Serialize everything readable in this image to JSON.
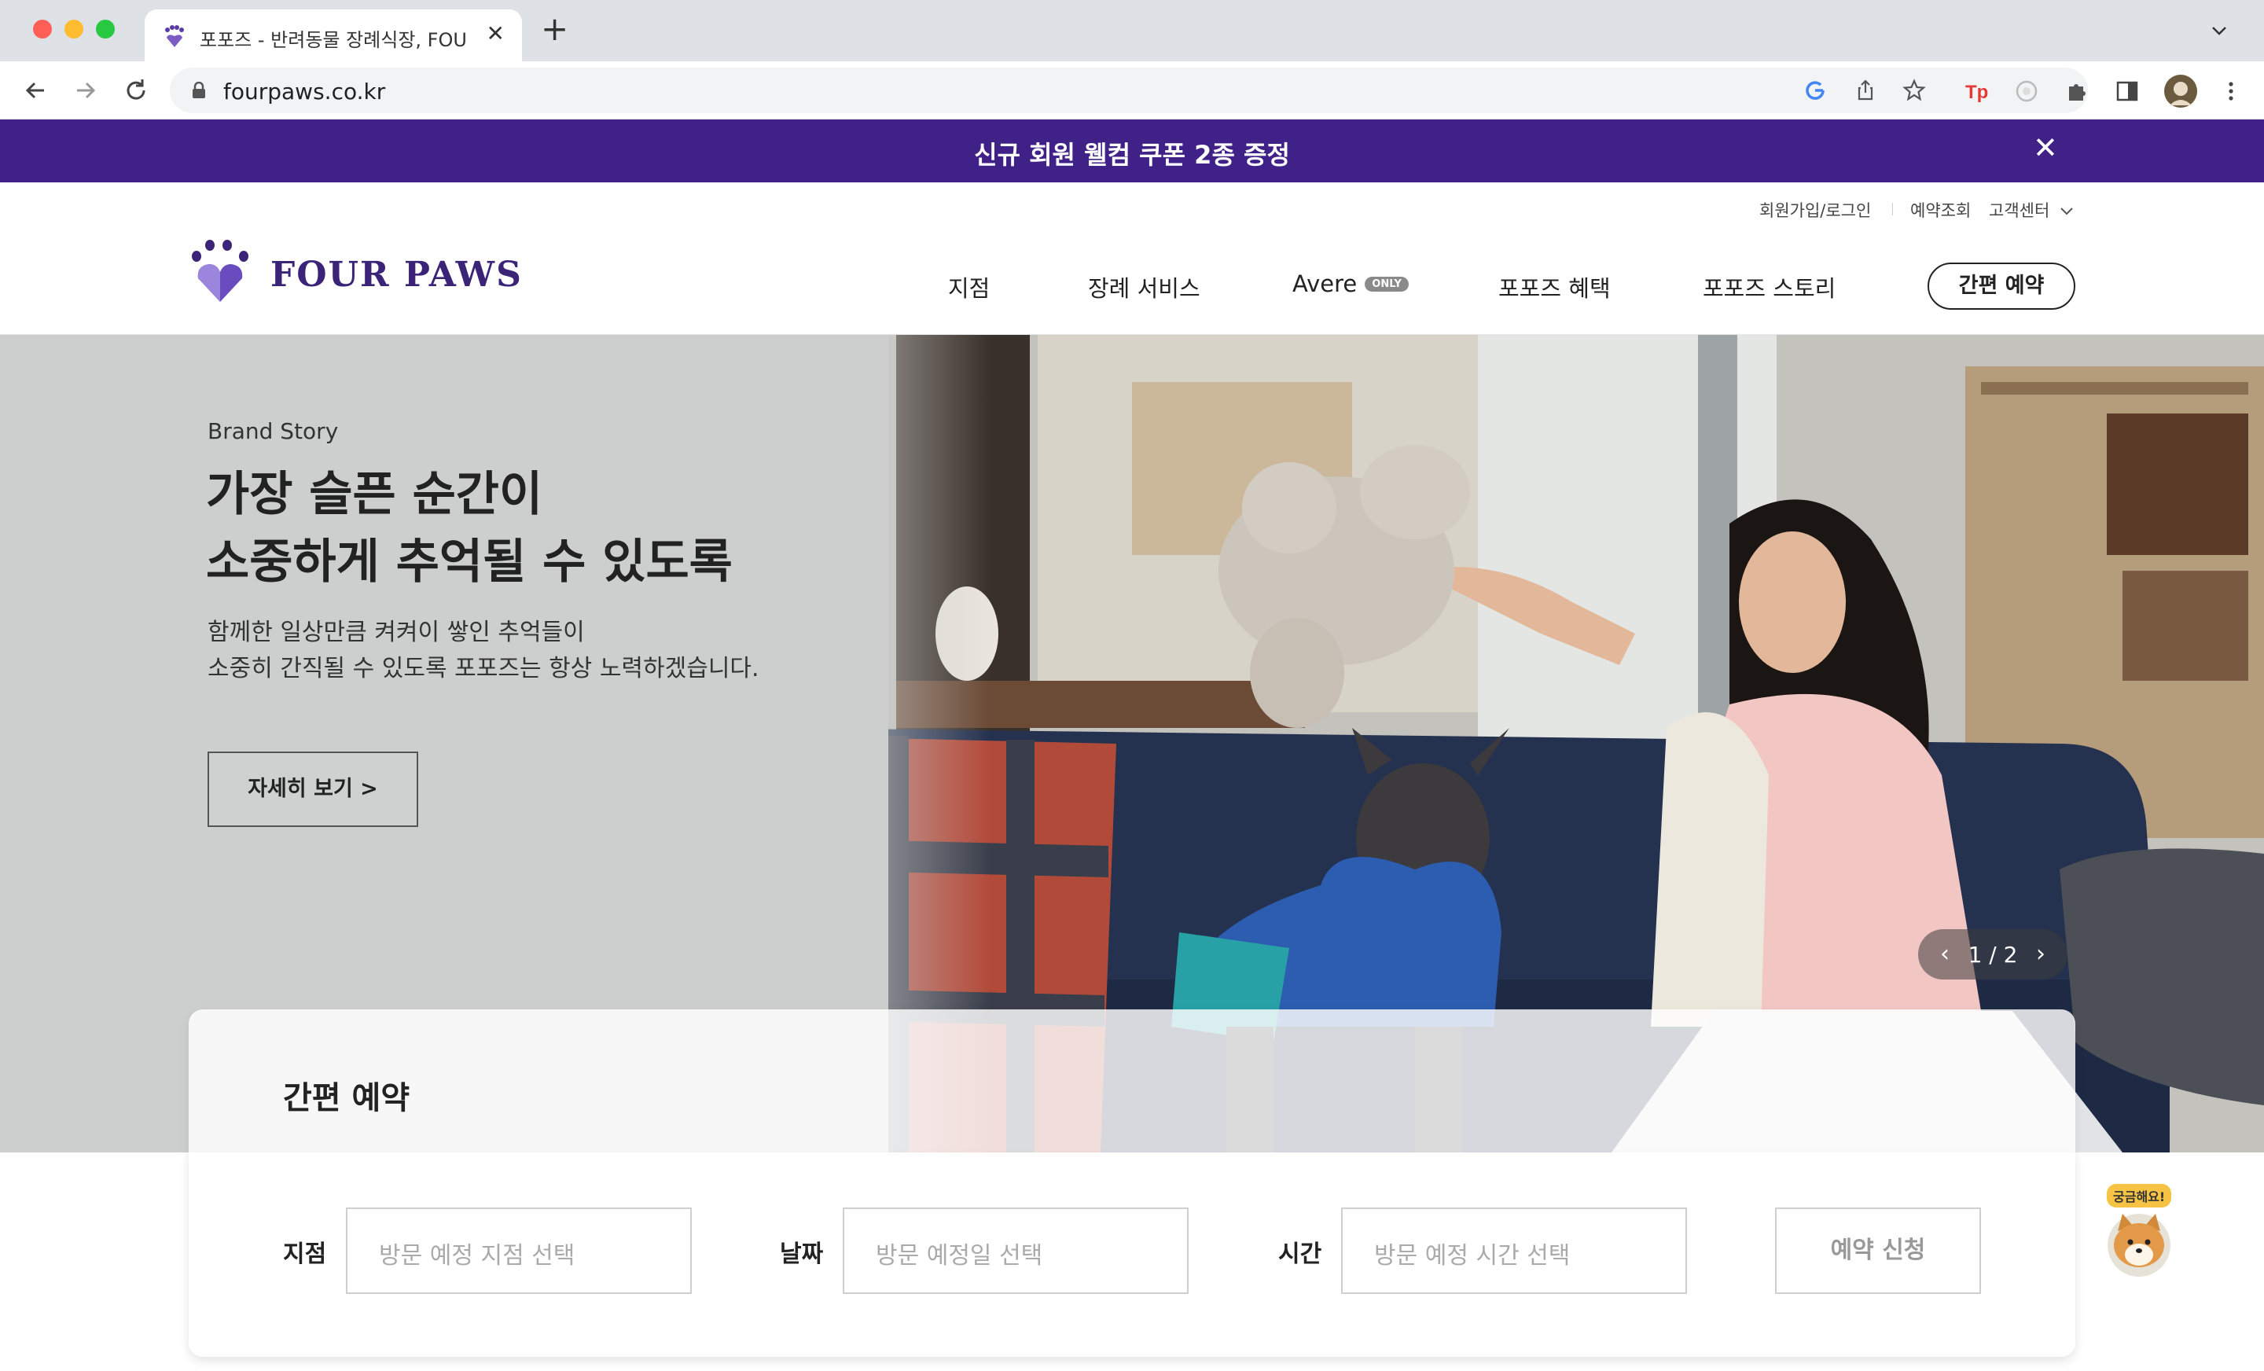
{
  "browser": {
    "tab_title": "포포즈 - 반려동물 장례식장, FOUR PAWS",
    "tab_close": "✕",
    "new_tab": "+",
    "url": "fourpaws.co.kr",
    "icons": [
      "back-icon",
      "forward-icon",
      "reload-icon",
      "lock-icon",
      "google-icon",
      "share-icon",
      "star-icon",
      "extension-tp-icon",
      "extension-icon",
      "puzzle-icon",
      "sidepanel-icon",
      "profile-avatar",
      "menu-icon"
    ]
  },
  "announcement": {
    "text": "신규 회원 웰컴 쿠폰 2종 증정",
    "close": "✕",
    "background": "#3f2188"
  },
  "header": {
    "util_links": {
      "login": "회원가입/로그인",
      "reservation_check": "예약조회",
      "customer_center": "고객센터"
    },
    "logo_text": "FOUR PAWS",
    "nav": {
      "branches": "지점",
      "funeral_service": "장례 서비스",
      "avere": "Avere",
      "avere_badge": "ONLY",
      "benefits": "포포즈 혜택",
      "story": "포포즈 스토리"
    },
    "quick_reserve": "간편 예약",
    "brand_color": "#3b2478"
  },
  "hero": {
    "eyebrow": "Brand Story",
    "title_line1": "가장 슬픈 순간이",
    "title_line2": "소중하게 추억될 수 있도록",
    "desc_line1": "함께한 일상만큼 켜켜이 쌓인 추억들이",
    "desc_line2": "소중히 간직될 수 있도록 포포즈는 항상 노력하겠습니다.",
    "detail_button": "자세히 보기 >",
    "pager": {
      "prev": "‹",
      "text": "1 / 2",
      "next": "›"
    }
  },
  "reservation": {
    "title": "간편 예약",
    "branch_label": "지점",
    "branch_placeholder": "방문 예정 지점 선택",
    "date_label": "날짜",
    "date_placeholder": "방문 예정일 선택",
    "time_label": "시간",
    "time_placeholder": "방문 예정 시간 선택",
    "submit": "예약 신청"
  },
  "help": {
    "bubble": "궁금해요!"
  }
}
